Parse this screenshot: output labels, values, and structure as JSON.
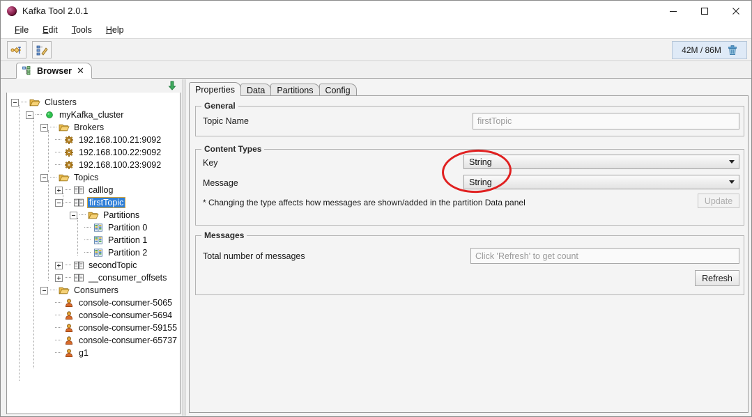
{
  "window": {
    "title": "Kafka Tool  2.0.1",
    "app_icon": "kafka-tool-icon",
    "minimize": "—",
    "maximize": "□",
    "close": "✕"
  },
  "menubar": {
    "items": [
      {
        "id": "file",
        "first": "F",
        "rest": "ile"
      },
      {
        "id": "edit",
        "first": "E",
        "rest": "dit"
      },
      {
        "id": "tools",
        "first": "T",
        "rest": "ools"
      },
      {
        "id": "help",
        "first": "H",
        "rest": "elp"
      }
    ]
  },
  "toolbar": {
    "buttons": [
      {
        "id": "add-cluster",
        "icon": "connect-cluster-icon"
      },
      {
        "id": "edit-cluster",
        "icon": "edit-tree-icon"
      }
    ],
    "memory": {
      "text": "42M / 86M",
      "icon": "trash-icon",
      "icon_color": "#4a8fc4",
      "bg": "#dfeaf7"
    }
  },
  "tabstrip": {
    "browser_tab": {
      "label": "Browser",
      "icon": "tree-browser-icon",
      "close": "✕"
    }
  },
  "tree_panel": {
    "header_icon": "collapse-all-icon",
    "header_icon_color": "#2e9e4e",
    "selection_bg": "#2f7fd8",
    "selection_border": "#d7a53a",
    "nodes": [
      {
        "id": "clusters",
        "label": "Clusters",
        "depth": 0,
        "toggle": "minus",
        "icon": "folder-open-icon",
        "selected": false
      },
      {
        "id": "mykafka-cluster",
        "label": "myKafka_cluster",
        "depth": 1,
        "toggle": "minus",
        "icon": "status-green-icon",
        "selected": false
      },
      {
        "id": "brokers",
        "label": "Brokers",
        "depth": 2,
        "toggle": "minus",
        "icon": "folder-open-icon",
        "selected": false
      },
      {
        "id": "broker-21",
        "label": "192.168.100.21:9092",
        "depth": 3,
        "toggle": "none",
        "icon": "gear-icon",
        "selected": false
      },
      {
        "id": "broker-22",
        "label": "192.168.100.22:9092",
        "depth": 3,
        "toggle": "none",
        "icon": "gear-icon",
        "selected": false
      },
      {
        "id": "broker-23",
        "label": "192.168.100.23:9092",
        "depth": 3,
        "toggle": "none",
        "icon": "gear-icon",
        "selected": false
      },
      {
        "id": "topics",
        "label": "Topics",
        "depth": 2,
        "toggle": "minus",
        "icon": "folder-open-icon",
        "selected": false
      },
      {
        "id": "topic-calllog",
        "label": "calllog",
        "depth": 3,
        "toggle": "plus",
        "icon": "topic-icon",
        "selected": false
      },
      {
        "id": "topic-firsttopic",
        "label": "firstTopic",
        "depth": 3,
        "toggle": "minus",
        "icon": "topic-icon",
        "selected": true
      },
      {
        "id": "partitions",
        "label": "Partitions",
        "depth": 4,
        "toggle": "minus",
        "icon": "folder-open-icon",
        "selected": false
      },
      {
        "id": "partition-0",
        "label": "Partition 0",
        "depth": 5,
        "toggle": "none",
        "icon": "partition-icon",
        "selected": false
      },
      {
        "id": "partition-1",
        "label": "Partition 1",
        "depth": 5,
        "toggle": "none",
        "icon": "partition-icon",
        "selected": false
      },
      {
        "id": "partition-2",
        "label": "Partition 2",
        "depth": 5,
        "toggle": "none",
        "icon": "partition-icon",
        "selected": false
      },
      {
        "id": "topic-secondtopic",
        "label": "secondTopic",
        "depth": 3,
        "toggle": "plus",
        "icon": "topic-icon",
        "selected": false
      },
      {
        "id": "topic-consumer-offsets",
        "label": "__consumer_offsets",
        "depth": 3,
        "toggle": "plus",
        "icon": "topic-icon",
        "selected": false
      },
      {
        "id": "consumers",
        "label": "Consumers",
        "depth": 2,
        "toggle": "minus",
        "icon": "folder-open-icon",
        "selected": false
      },
      {
        "id": "consumer-5065",
        "label": "console-consumer-5065",
        "depth": 3,
        "toggle": "none",
        "icon": "consumer-icon",
        "selected": false
      },
      {
        "id": "consumer-5694",
        "label": "console-consumer-5694",
        "depth": 3,
        "toggle": "none",
        "icon": "consumer-icon",
        "selected": false
      },
      {
        "id": "consumer-59155",
        "label": "console-consumer-59155",
        "depth": 3,
        "toggle": "none",
        "icon": "consumer-icon",
        "selected": false
      },
      {
        "id": "consumer-65737",
        "label": "console-consumer-65737",
        "depth": 3,
        "toggle": "none",
        "icon": "consumer-icon",
        "selected": false
      },
      {
        "id": "consumer-g1",
        "label": "g1",
        "depth": 3,
        "toggle": "none",
        "icon": "consumer-icon",
        "selected": false
      }
    ]
  },
  "detail_panel": {
    "tabs": [
      {
        "id": "properties",
        "label": "Properties",
        "active": true
      },
      {
        "id": "data",
        "label": "Data",
        "active": false
      },
      {
        "id": "partitions",
        "label": "Partitions",
        "active": false
      },
      {
        "id": "config",
        "label": "Config",
        "active": false
      }
    ],
    "general": {
      "title": "General",
      "topic_name_label": "Topic Name",
      "topic_name_value": "firstTopic"
    },
    "content_types": {
      "title": "Content Types",
      "key_label": "Key",
      "key_value": "String",
      "message_label": "Message",
      "message_value": "String",
      "note": "* Changing the type affects how messages are shown/added in the partition Data panel",
      "update_label": "Update",
      "update_disabled": true
    },
    "messages": {
      "title": "Messages",
      "total_label": "Total number of messages",
      "count_placeholder": "Click 'Refresh' to get count",
      "count_value": "",
      "refresh_label": "Refresh"
    }
  },
  "annotation": {
    "ellipse_color": "#e02020",
    "target": "content-types-dropdowns"
  }
}
